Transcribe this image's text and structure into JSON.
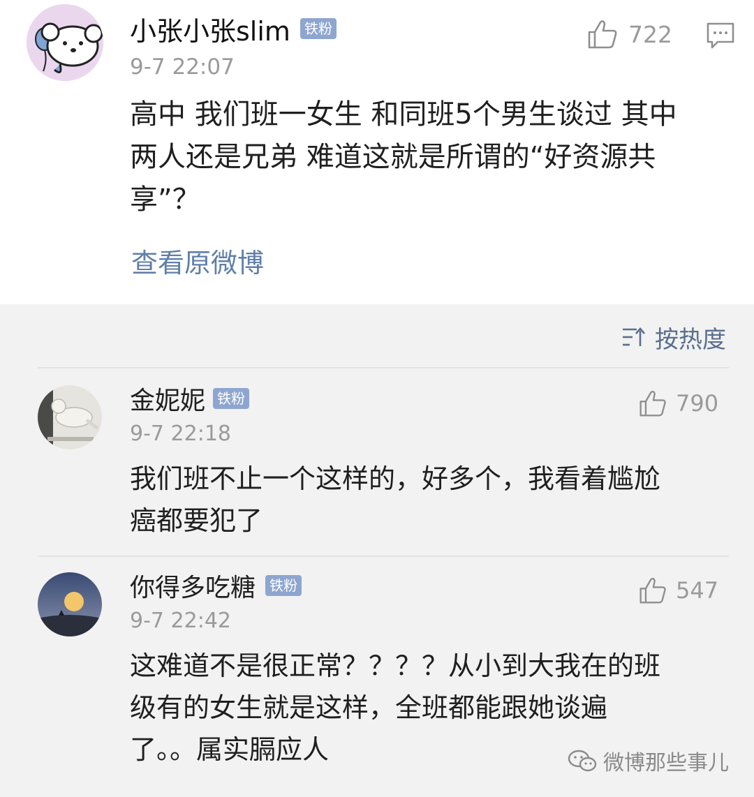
{
  "main_post": {
    "username": "小张小张slim",
    "badge": "铁粉",
    "time": "9-7 22:07",
    "likes": "722",
    "text": "高中 我们班一女生 和同班5个男生谈过 其中\n两人还是兄弟 难道这就是所谓的“好资源共\n享”？",
    "view_original": "查看原微博",
    "avatar": "cartoon-dog-avatar",
    "comment_icon": "comment-bubble-icon"
  },
  "sort": {
    "label": "按热度",
    "icon": "sort-icon"
  },
  "comments": [
    {
      "username": "金妮妮",
      "badge": "铁粉",
      "time": "9-7 22:18",
      "likes": "790",
      "text": "我们班不止一个这样的，好多个，我看着尴尬\n癌都要犯了",
      "avatar": "cat-photo-avatar"
    },
    {
      "username": "你得多吃糖",
      "badge": "铁粉",
      "time": "9-7 22:42",
      "likes": "547",
      "text": "这难道不是很正常？？？？从小到大我在的班\n级有的女生就是这样，全班都能跟她谈遍\n了。。属实膈应人",
      "avatar": "moon-photo-avatar"
    }
  ],
  "watermark": {
    "label": "微博那些事儿",
    "icon": "wechat-icon"
  },
  "colors": {
    "badge": "#8ea6cf",
    "link": "#5f7fa8",
    "muted": "#9a9a9a",
    "background": "#f2f2f2"
  }
}
